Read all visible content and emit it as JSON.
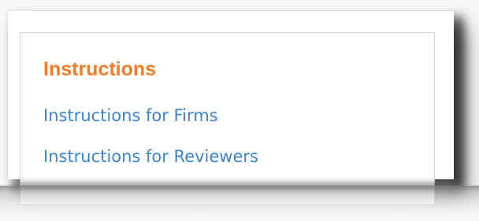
{
  "panel": {
    "heading": "Instructions",
    "heading_color": "#f47c26",
    "link_color": "#3c83c9",
    "links": [
      {
        "label": "Instructions for Firms"
      },
      {
        "label": "Instructions for Reviewers"
      }
    ]
  }
}
